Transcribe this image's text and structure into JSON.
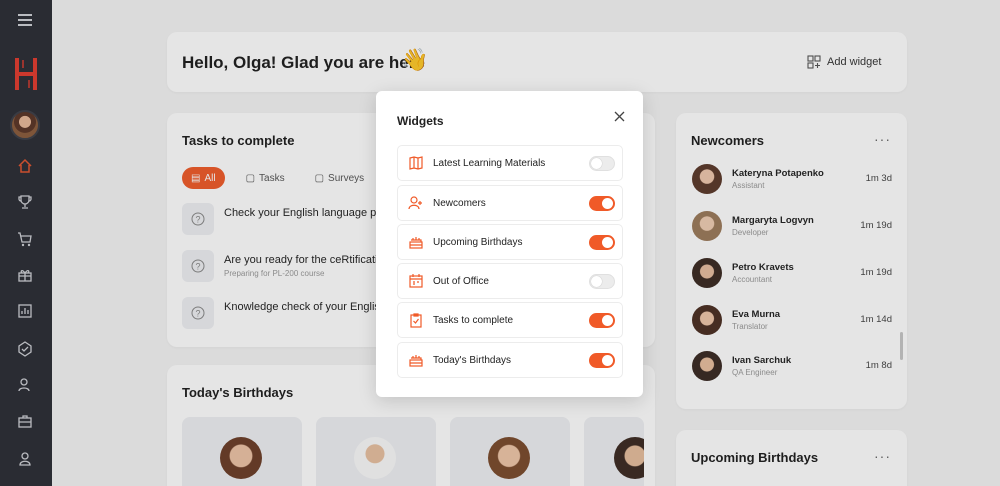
{
  "greeting": "Hello, Olga! Glad you are here",
  "add_widget_label": "Add widget",
  "tasks": {
    "title": "Tasks to complete",
    "filters": [
      {
        "label": "All"
      },
      {
        "label": "Tasks"
      },
      {
        "label": "Surveys"
      }
    ],
    "items": [
      {
        "title": "Check your English language pro",
        "subtitle": ""
      },
      {
        "title": "Are you ready for the ceRtification",
        "subtitle": "Preparing for PL-200 course"
      },
      {
        "title": "Knowledge check of your Englis",
        "subtitle": ""
      }
    ]
  },
  "birthdays": {
    "title": "Today's Birthdays"
  },
  "newcomers": {
    "title": "Newcomers",
    "people": [
      {
        "name": "Kateryna Potapenko",
        "role": "Assistant",
        "time": "1m 3d"
      },
      {
        "name": "Margaryta Logvyn",
        "role": "Developer",
        "time": "1m 19d"
      },
      {
        "name": "Petro Kravets",
        "role": "Accountant",
        "time": "1m 19d"
      },
      {
        "name": "Eva Murna",
        "role": "Translator",
        "time": "1m 14d"
      },
      {
        "name": "Ivan Sarchuk",
        "role": "QA Engineer",
        "time": "1m 8d"
      }
    ]
  },
  "upcoming": {
    "title": "Upcoming Birthdays"
  },
  "modal": {
    "title": "Widgets",
    "widgets": [
      {
        "label": "Latest Learning Materials",
        "enabled": false,
        "icon": "book-icon"
      },
      {
        "label": "Newcomers",
        "enabled": true,
        "icon": "user-plus-icon"
      },
      {
        "label": "Upcoming Birthdays",
        "enabled": true,
        "icon": "cake-icon"
      },
      {
        "label": "Out of Office",
        "enabled": false,
        "icon": "calendar-icon"
      },
      {
        "label": "Tasks to complete",
        "enabled": true,
        "icon": "clipboard-check-icon"
      },
      {
        "label": "Today's Birthdays",
        "enabled": true,
        "icon": "cake-icon"
      }
    ]
  },
  "colors": {
    "accent": "#f05a28",
    "sidebar": "#2b2d35"
  }
}
